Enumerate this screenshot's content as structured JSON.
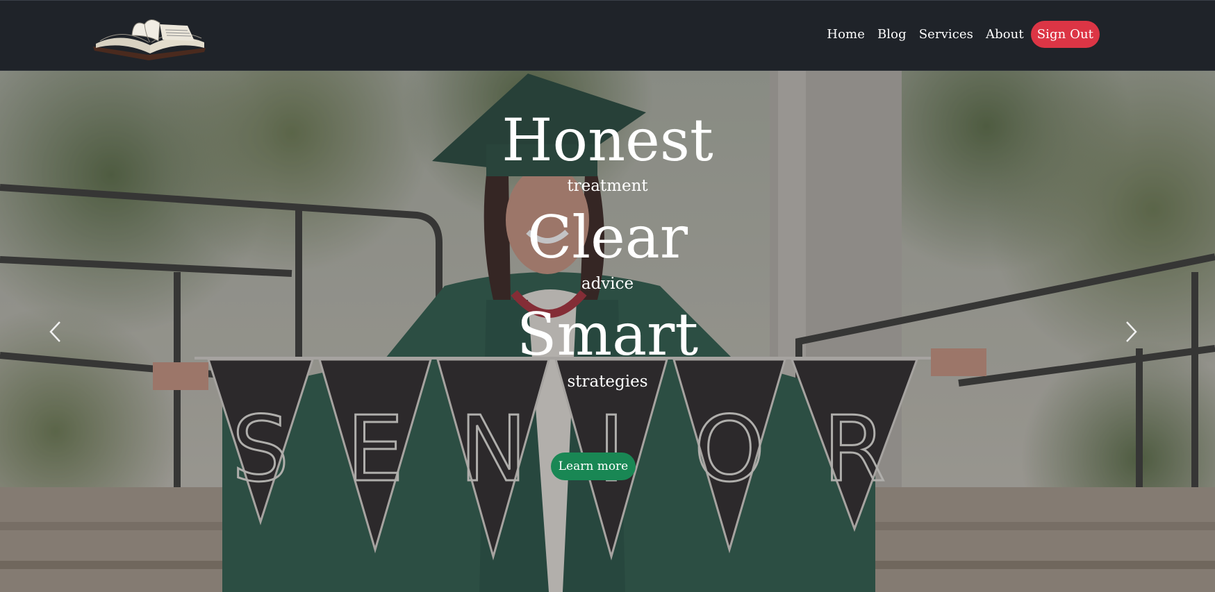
{
  "nav": {
    "logo_icon": "open-book-heart-logo",
    "items": [
      "Home",
      "Blog",
      "Services",
      "About"
    ],
    "signout_label": "Sign Out"
  },
  "hero": {
    "lines": [
      {
        "big": "Honest",
        "small": "treatment"
      },
      {
        "big": "Clear",
        "small": "advice"
      },
      {
        "big": "Smart",
        "small": "strategies"
      }
    ],
    "button_label": "Learn more",
    "prev_icon": "chevron-left-icon",
    "next_icon": "chevron-right-icon",
    "banner_letters": [
      "S",
      "E",
      "N",
      "I",
      "O",
      "R"
    ]
  },
  "colors": {
    "navbar": "#1f2329",
    "signout": "#dc3545",
    "learn_more": "#198754"
  }
}
